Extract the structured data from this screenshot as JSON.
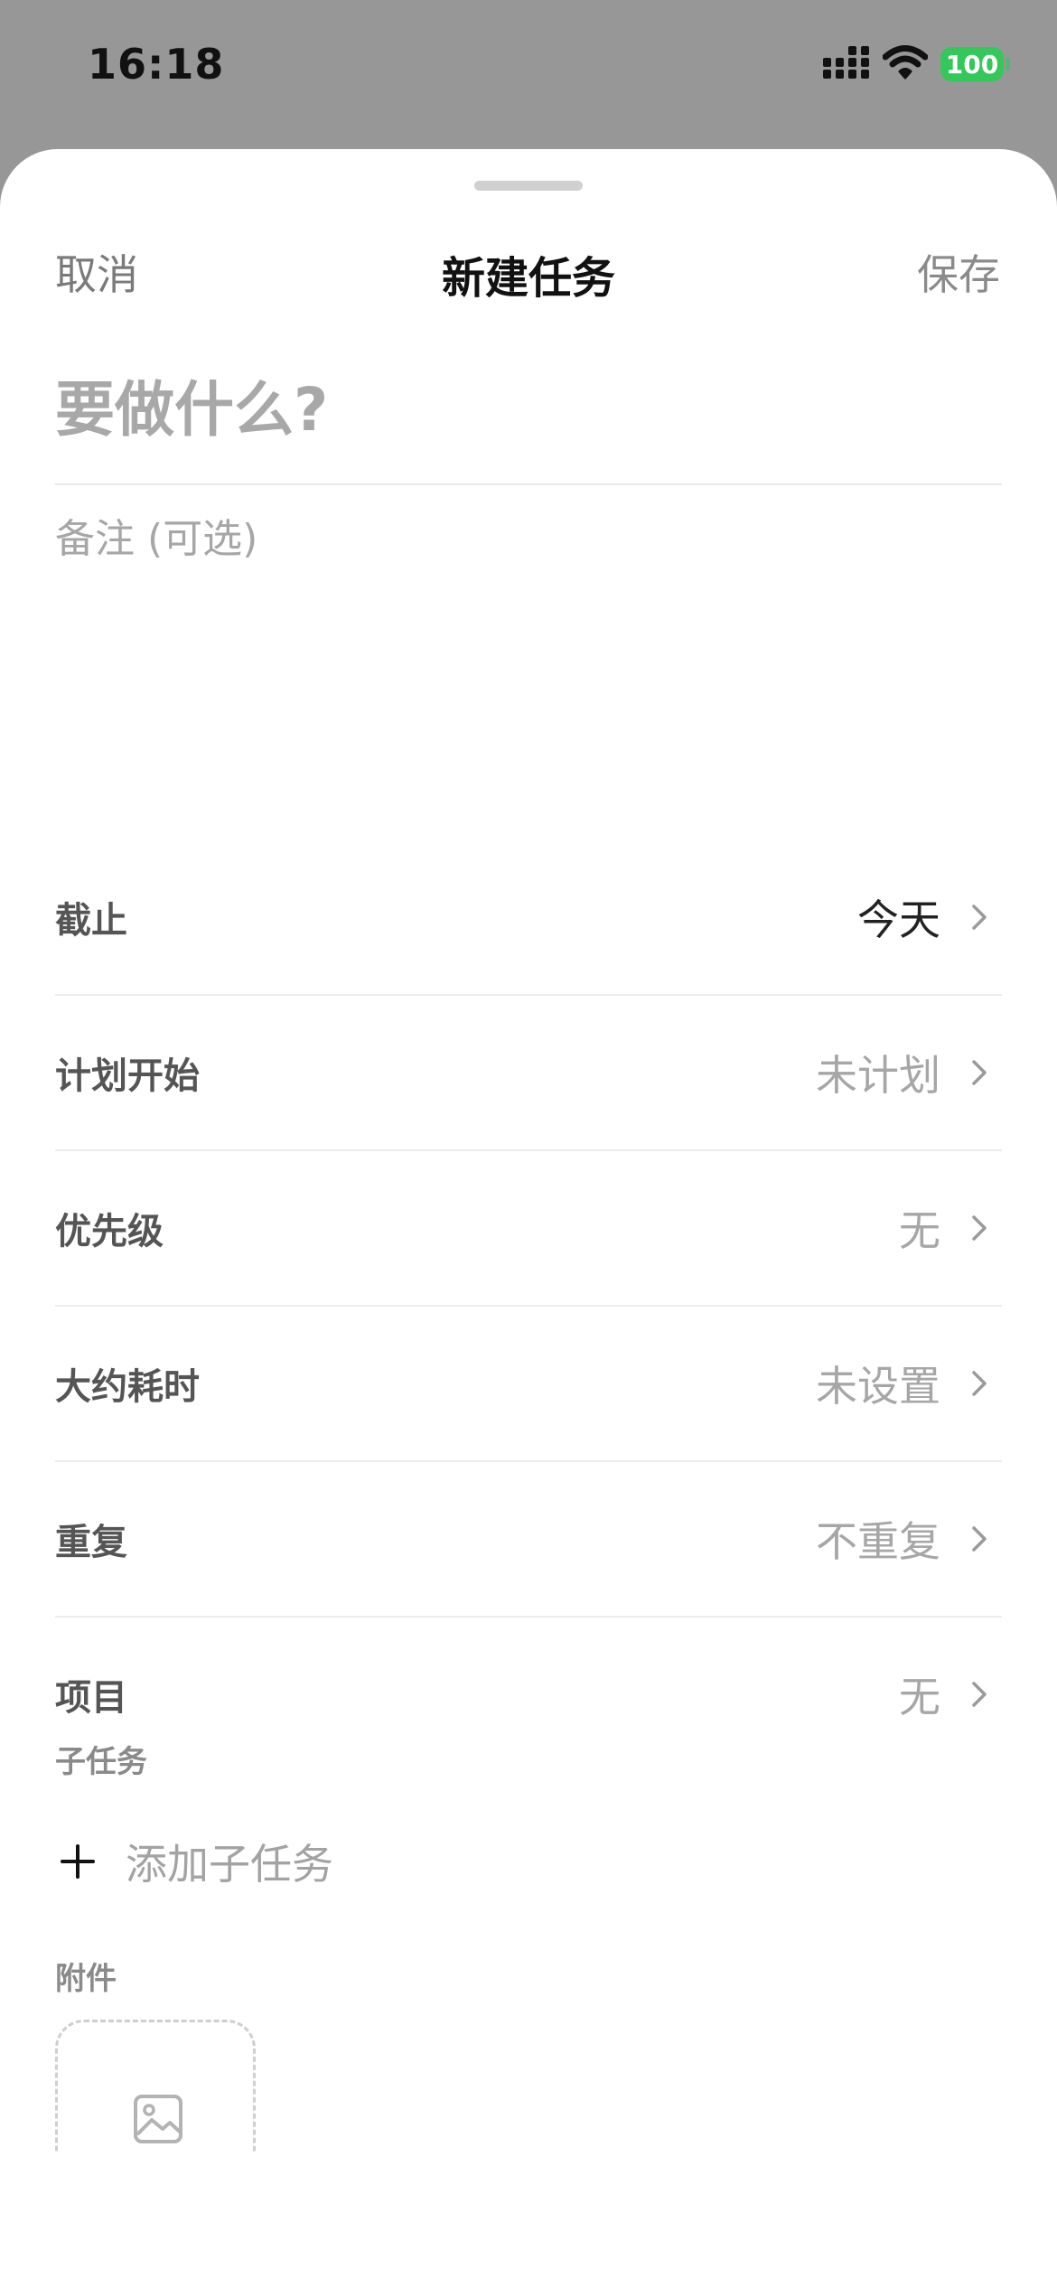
{
  "status_bar": {
    "time": "16:18",
    "battery": "100"
  },
  "nav": {
    "cancel_label": "取消",
    "title": "新建任务",
    "save_label": "保存"
  },
  "task": {
    "title_placeholder": "要做什么?",
    "title_value": "",
    "notes_placeholder": "备注 (可选)",
    "notes_value": ""
  },
  "settings": [
    {
      "label": "截止",
      "value": "今天"
    },
    {
      "label": "计划开始",
      "value": "未计划"
    },
    {
      "label": "优先级",
      "value": "无"
    },
    {
      "label": "大约耗时",
      "value": "未设置"
    },
    {
      "label": "重复",
      "value": "不重复"
    },
    {
      "label": "项目",
      "value": "无"
    }
  ],
  "subtasks": {
    "section_label": "子任务",
    "add_label": "添加子任务"
  },
  "attachments": {
    "section_label": "附件"
  },
  "colors": {
    "sheet_background": "#ffffff",
    "page_background": "#979797",
    "battery_green": "#34c759",
    "placeholder_gray": "#a6a6a6",
    "active_value": "#222222"
  }
}
